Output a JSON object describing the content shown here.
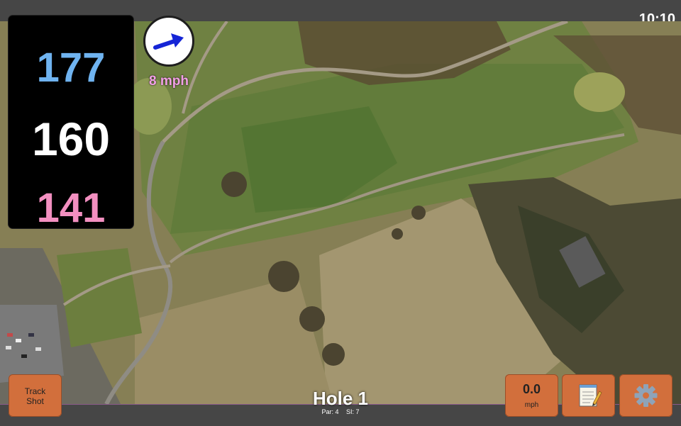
{
  "status_bar": {
    "time": "10:10"
  },
  "distances": {
    "back": "177",
    "middle": "160",
    "front": "141"
  },
  "wind": {
    "speed": "8 mph",
    "icon": "wind-arrow-icon"
  },
  "hole": {
    "title": "Hole 1",
    "par": "Par: 4",
    "stroke_index": "SI: 7"
  },
  "buttons": {
    "track_shot_line1": "Track",
    "track_shot_line2": "Shot",
    "speed_value": "0.0",
    "speed_unit": "mph",
    "notes_icon": "notepad-icon",
    "settings_icon": "gear-icon"
  },
  "colors": {
    "back_distance": "#6fb3f0",
    "middle_distance": "#ffffff",
    "front_distance": "#f28fc0",
    "wind_text": "#f2a0e6",
    "button": "#d26f3c"
  }
}
